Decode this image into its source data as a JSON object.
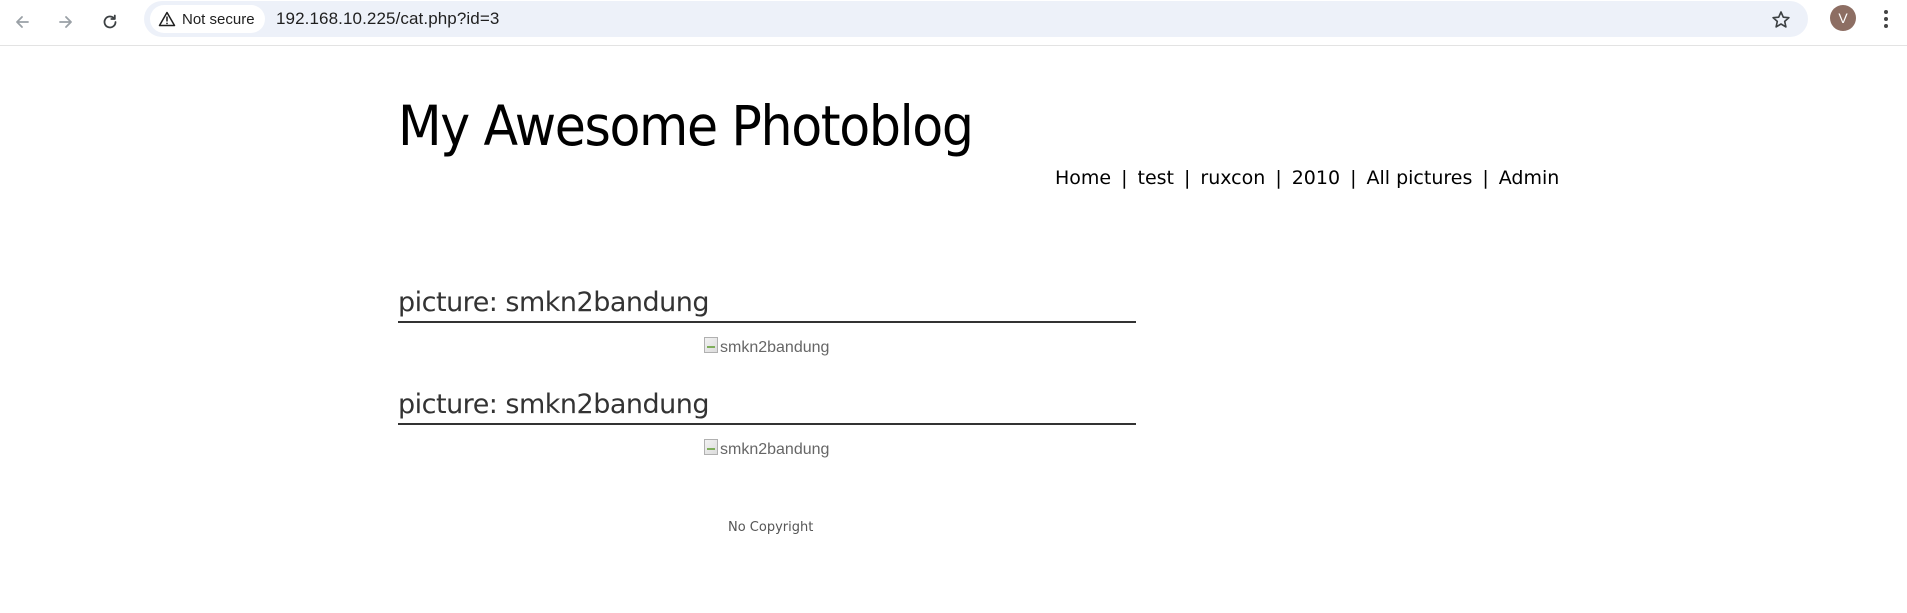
{
  "browser": {
    "security_label": "Not secure",
    "url": "192.168.10.225/cat.php?id=3",
    "profile_initial": "V",
    "icons": {
      "back": "arrow-left-icon",
      "forward": "arrow-right-icon",
      "reload": "reload-icon",
      "security": "warning-triangle-icon",
      "bookmark": "star-icon",
      "menu": "kebab-menu-icon"
    },
    "profile_color": "#8d6e63",
    "omnibox_color": "#edf1f9"
  },
  "site": {
    "title": "My Awesome Photoblog",
    "nav": [
      {
        "label": "Home"
      },
      {
        "label": "test"
      },
      {
        "label": "ruxcon"
      },
      {
        "label": "2010"
      },
      {
        "label": "All pictures"
      },
      {
        "label": "Admin"
      }
    ],
    "nav_separator": "|"
  },
  "posts": [
    {
      "prefix": "picture:",
      "name": "smkn2bandung",
      "image_alt": "smkn2bandung"
    },
    {
      "prefix": "picture:",
      "name": "smkn2bandung",
      "image_alt": "smkn2bandung"
    }
  ],
  "footer": {
    "text": "No Copyright"
  }
}
